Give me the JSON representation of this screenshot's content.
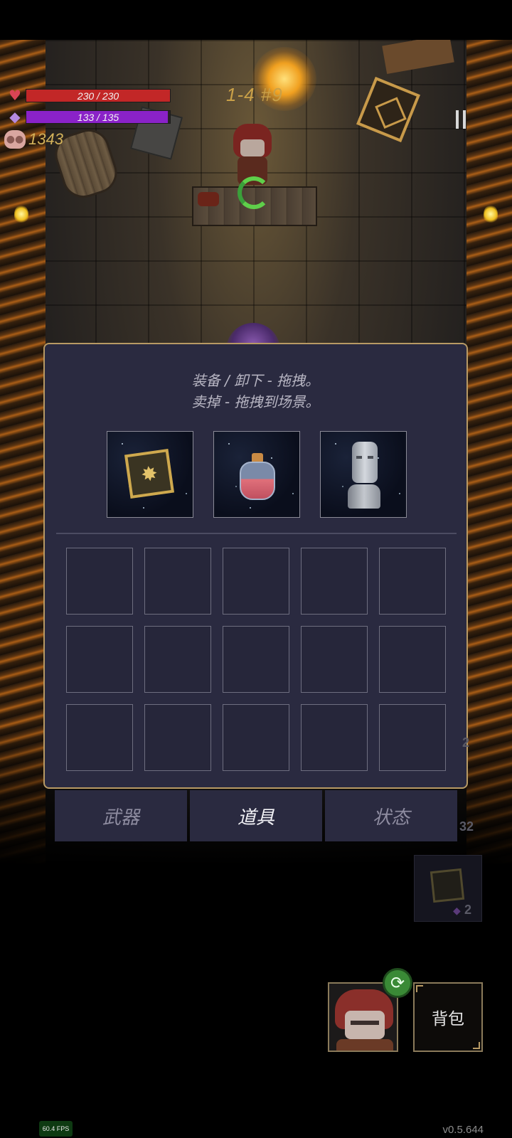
{
  "hud": {
    "hp": {
      "text": "230 / 230",
      "fraction": 1.0,
      "icon": "heart-icon"
    },
    "mp": {
      "text": "133 / 135",
      "fraction": 0.985,
      "icon": "gem-icon"
    },
    "gold": {
      "value": "1343",
      "icon": "pig-icon"
    },
    "level": "1-4 #9",
    "pause_icon": "pause-icon"
  },
  "inventory": {
    "instruction_line1": "装备 / 卸下 - 拖拽。",
    "instruction_line2": "卖掉 - 拖拽到场景。",
    "equipped": [
      "rune-cube-item",
      "red-potion-item",
      "stone-head-statue-item"
    ],
    "grid_rows": 3,
    "grid_cols": 5
  },
  "tabs": [
    {
      "label": "武器",
      "active": false
    },
    {
      "label": "道具",
      "active": true
    },
    {
      "label": "状态",
      "active": false
    }
  ],
  "side": {
    "count_a": "2",
    "count_b": "32",
    "mini_slot_count": "2"
  },
  "bottom": {
    "backpack_label": "背包",
    "swap_icon": "refresh-icon"
  },
  "fps": "60.4 FPS",
  "version": "v0.5.644",
  "colors": {
    "hp_bar": "#c22727",
    "mp_bar": "#8a22c8",
    "panel_bg": "#2a2a40",
    "panel_border": "#b89a64",
    "gold_text": "#d3b25a"
  }
}
